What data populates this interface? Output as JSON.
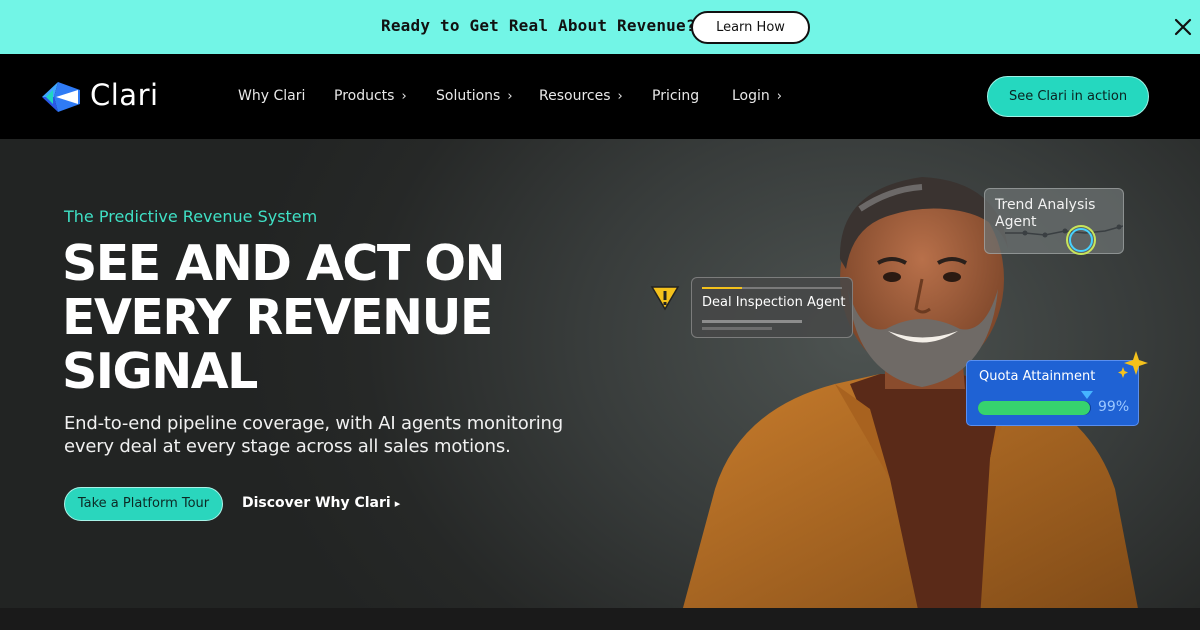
{
  "banner": {
    "text": "Ready to Get Real About Revenue?",
    "button_label": "Learn How",
    "close_icon": "close-icon"
  },
  "nav": {
    "logo_text": "Clari",
    "items": [
      {
        "label": "Why Clari",
        "has_chevron": false
      },
      {
        "label": "Products",
        "has_chevron": true
      },
      {
        "label": "Solutions",
        "has_chevron": true
      },
      {
        "label": "Resources",
        "has_chevron": true
      },
      {
        "label": "Pricing",
        "has_chevron": false
      },
      {
        "label": "Login",
        "has_chevron": true
      }
    ],
    "chevron": "›",
    "cta_label": "See Clari in action"
  },
  "hero": {
    "eyebrow": "The Predictive Revenue System",
    "headline_lines": [
      "SEE AND ACT ON",
      "EVERY REVENUE",
      "SIGNAL"
    ],
    "subcopy": "End-to-end pipeline coverage, with AI agents monitoring every deal at every stage across all sales motions.",
    "primary_button": "Take a Platform Tour",
    "secondary_link": "Discover Why Clari",
    "secondary_link_arrow": "▸"
  },
  "cards": {
    "trend": {
      "label": "Trend Analysis Agent"
    },
    "deal": {
      "label": "Deal Inspection Agent",
      "icon": "warning-icon"
    },
    "quota": {
      "label": "Quota Attainment",
      "value_text": "99%",
      "progress": 0.99,
      "icon": "sparkle-icon"
    }
  },
  "colors": {
    "banner_bg": "#72f5e6",
    "accent": "#2ad6bd",
    "eyebrow": "#3fe0c5",
    "quota_card": "#1f62d4",
    "quota_fill": "#36d36e",
    "warning": "#f4c11c"
  }
}
